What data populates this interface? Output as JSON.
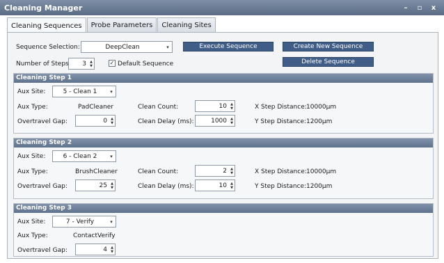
{
  "window": {
    "title": "Cleaning Manager",
    "minimize_glyph": "–",
    "restore_glyph": "▫",
    "close_glyph": "x"
  },
  "tabs": [
    {
      "label": "Cleaning Sequences",
      "active": true
    },
    {
      "label": "Probe Parameters",
      "active": false
    },
    {
      "label": "Cleaning Sites",
      "active": false
    }
  ],
  "sequence": {
    "selection_label": "Sequence Selection:",
    "selection_value": "DeepClean",
    "steps_label": "Number of Steps:",
    "steps_value": "3",
    "default_label": "Default Sequence",
    "default_checked": true,
    "check_glyph": "✓",
    "execute_button": "Execute Sequence",
    "create_button": "Create New Sequence",
    "delete_button": "Delete Sequence"
  },
  "labels": {
    "aux_site": "Aux Site:",
    "aux_type": "Aux Type:",
    "overtravel_gap": "Overtravel Gap:",
    "clean_count": "Clean Count:",
    "clean_delay": "Clean Delay (ms):",
    "x_step": "X Step Distance:",
    "y_step": "Y Step Distance:"
  },
  "steps": [
    {
      "title": "Cleaning Step 1",
      "aux_site": "5 - Clean 1",
      "aux_type": "PadCleaner",
      "overtravel_gap": "0",
      "clean_count": "10",
      "clean_delay": "1000",
      "x_step": "10000µm",
      "y_step": "1200µm"
    },
    {
      "title": "Cleaning Step 2",
      "aux_site": "6 - Clean 2",
      "aux_type": "BrushCleaner",
      "overtravel_gap": "25",
      "clean_count": "2",
      "clean_delay": "10",
      "x_step": "10000µm",
      "y_step": "1200µm"
    },
    {
      "title": "Cleaning Step 3",
      "aux_site": "7 - Verify",
      "aux_type": "ContactVerify",
      "overtravel_gap": "4"
    }
  ],
  "icons": {
    "dropdown": "▾",
    "spin_up": "▲",
    "spin_down": "▼"
  },
  "colors": {
    "titlebar": "#5f728c",
    "button": "#3f5d86",
    "panel": "#f3f4f6"
  }
}
